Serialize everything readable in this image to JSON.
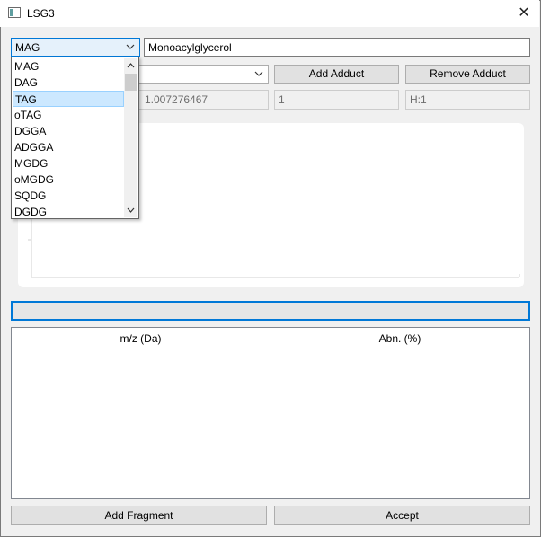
{
  "window": {
    "title": "LSG3",
    "close_glyph": "✕"
  },
  "lipid_class": {
    "selected": "MAG",
    "options": [
      "MAG",
      "DAG",
      "TAG",
      "oTAG",
      "DGGA",
      "ADGGA",
      "MGDG",
      "oMGDG",
      "SQDG",
      "DGDG"
    ],
    "highlighted": "TAG"
  },
  "lipid_name": {
    "value": "Monoacylglycerol"
  },
  "adduct": {
    "selected": "",
    "add_label": "Add Adduct",
    "remove_label": "Remove Adduct"
  },
  "adduct_info": {
    "mass": "1.007276467",
    "charge": "1",
    "formula": "H:1"
  },
  "table": {
    "columns": [
      "m/z (Da)",
      "Abn. (%)"
    ]
  },
  "buttons": {
    "add_fragment": "Add Fragment",
    "accept": "Accept"
  },
  "icons": {
    "app": "window-app-icon",
    "close": "close-icon",
    "arrow": "chevron-down-icon"
  },
  "colors": {
    "accent": "#0078d7",
    "highlight": "#cce8ff"
  }
}
